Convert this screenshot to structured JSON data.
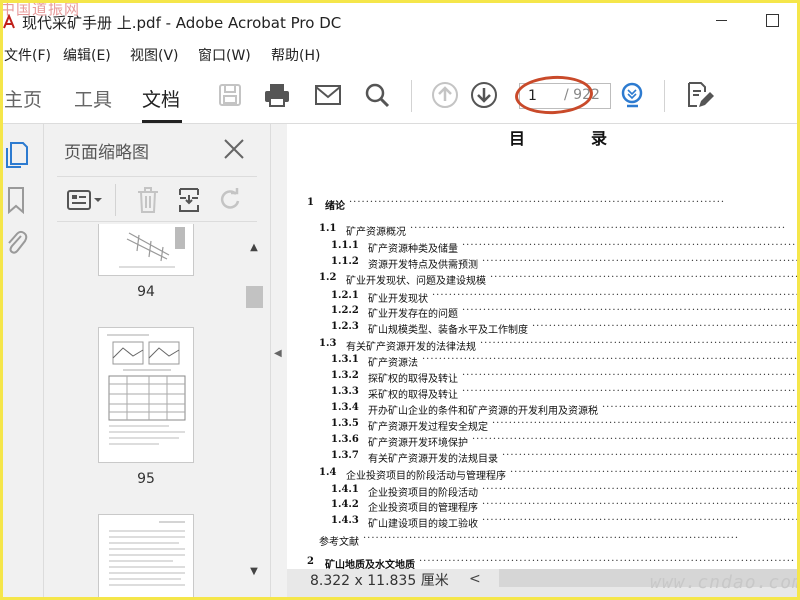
{
  "window": {
    "title": "现代采矿手册 上.pdf - Adobe Acrobat Pro DC",
    "watermark_top": "中国道振网",
    "watermark_bottom": "www.cndao.com"
  },
  "menu": [
    "文件(F)",
    "编辑(E)",
    "视图(V)",
    "窗口(W)",
    "帮助(H)"
  ],
  "tabs": [
    "主页",
    "工具",
    "文档"
  ],
  "toolbar": {
    "icons": [
      "save-icon",
      "print-icon",
      "email-icon",
      "search-icon",
      "page-up-icon",
      "page-down-icon",
      "zoom-icon",
      "edit-pdf-icon"
    ],
    "page_current": "1",
    "page_total": "/ 922"
  },
  "left_rail": {
    "icons": [
      "page-thumbnails-icon",
      "bookmark-icon",
      "attachment-icon"
    ]
  },
  "thumb_panel": {
    "title": "页面缩略图",
    "tools": [
      "page-options-icon",
      "delete-icon",
      "extract-icon",
      "rotate-icon"
    ],
    "pages": [
      "94",
      "95",
      ""
    ]
  },
  "document": {
    "heading_left": "目",
    "heading_right": "录",
    "toc": [
      {
        "level": 0,
        "num": "1",
        "title": "绪论"
      },
      {
        "level": 1,
        "num": "1.1",
        "title": "矿产资源概况"
      },
      {
        "level": 2,
        "num": "1.1.1",
        "title": "矿产资源种类及储量"
      },
      {
        "level": 2,
        "num": "1.1.2",
        "title": "资源开发特点及供需预测"
      },
      {
        "level": 1,
        "num": "1.2",
        "title": "矿业开发现状、问题及建设规模"
      },
      {
        "level": 2,
        "num": "1.2.1",
        "title": "矿业开发现状"
      },
      {
        "level": 2,
        "num": "1.2.2",
        "title": "矿业开发存在的问题"
      },
      {
        "level": 2,
        "num": "1.2.3",
        "title": "矿山规模类型、装备水平及工作制度"
      },
      {
        "level": 1,
        "num": "1.3",
        "title": "有关矿产资源开发的法律法规"
      },
      {
        "level": 2,
        "num": "1.3.1",
        "title": "矿产资源法"
      },
      {
        "level": 2,
        "num": "1.3.2",
        "title": "探矿权的取得及转让"
      },
      {
        "level": 2,
        "num": "1.3.3",
        "title": "采矿权的取得及转让"
      },
      {
        "level": 2,
        "num": "1.3.4",
        "title": "开办矿山企业的条件和矿产资源的开发利用及资源税"
      },
      {
        "level": 2,
        "num": "1.3.5",
        "title": "矿产资源开发过程安全规定"
      },
      {
        "level": 2,
        "num": "1.3.6",
        "title": "矿产资源开发环境保护"
      },
      {
        "level": 2,
        "num": "1.3.7",
        "title": "有关矿产资源开发的法规目录"
      },
      {
        "level": 1,
        "num": "1.4",
        "title": "企业投资项目的阶段活动与管理程序"
      },
      {
        "level": 2,
        "num": "1.4.1",
        "title": "企业投资项目的阶段活动"
      },
      {
        "level": 2,
        "num": "1.4.2",
        "title": "企业投资项目的管理程序"
      },
      {
        "level": 2,
        "num": "1.4.3",
        "title": "矿山建设项目的竣工验收"
      },
      {
        "level": 1,
        "num": "",
        "title": "参考文献"
      },
      {
        "level": 0,
        "num": "2",
        "title": "矿山地质及水文地质"
      }
    ]
  },
  "status": {
    "page_size": "8.322 x 11.835 厘米",
    "scroll_left": "<"
  }
}
